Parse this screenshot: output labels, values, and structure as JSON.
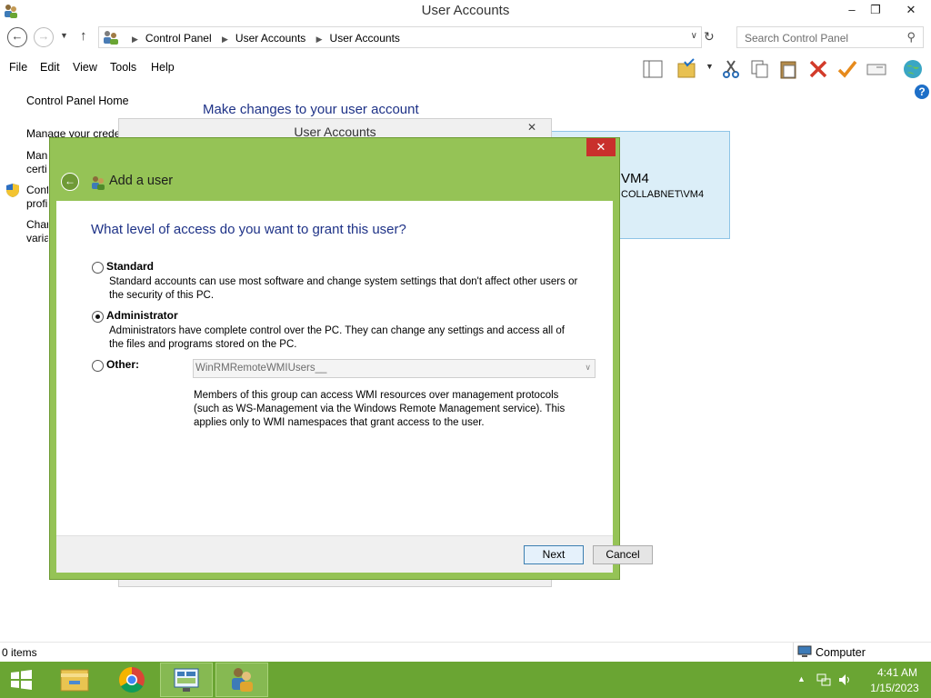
{
  "window": {
    "title": "User Accounts",
    "minimize_glyph": "–",
    "maximize_glyph": "❐",
    "close_glyph": "✕"
  },
  "address": {
    "crumbs": [
      "Control Panel",
      "User Accounts",
      "User Accounts"
    ],
    "search_placeholder": "Search Control Panel"
  },
  "menu": {
    "items": [
      "File",
      "Edit",
      "View",
      "Tools",
      "Help"
    ]
  },
  "toolbar_icons": [
    "layout-icon",
    "folder-check-icon",
    "cut-icon",
    "copy-icon",
    "paste-icon",
    "delete-icon",
    "checkmark-icon",
    "rename-icon",
    "globe-icon"
  ],
  "left_nav": {
    "home": "Control Panel Home",
    "items": [
      "Manage your crede",
      "Man",
      "certi",
      "Confi",
      "profi",
      "Char",
      "varia"
    ]
  },
  "main": {
    "heading": "Make changes to your user account"
  },
  "account_card": {
    "name": "VM4",
    "domain": "COLLABNET\\VM4"
  },
  "bg_dialog": {
    "title": "User Accounts",
    "close_glyph": "✕"
  },
  "dialog": {
    "close_glyph": "✕",
    "back_glyph": "←",
    "header": "Add a user",
    "question": "What level of access do you want to grant this user?",
    "options": [
      {
        "label": "Standard",
        "desc1": "Standard accounts can use most software and change system settings that don't affect other users or",
        "desc2": "the security of this PC.",
        "checked": false
      },
      {
        "label": "Administrator",
        "desc1": "Administrators have complete control over the PC. They can change any settings and access all of",
        "desc2": "the files and programs stored on the PC.",
        "checked": true
      },
      {
        "label": "Other:",
        "checked": false
      }
    ],
    "group_value": "WinRMRemoteWMIUsers__",
    "group_desc": [
      "Members of this group can access WMI resources over management protocols",
      "(such as WS-Management via the Windows Remote Management service). This",
      "applies only to WMI namespaces that grant access to the user."
    ],
    "next": "Next",
    "cancel": "Cancel"
  },
  "status": {
    "items": "0 items",
    "location": "Computer"
  },
  "taskbar": {
    "apps": [
      "start-button",
      "file-explorer",
      "chrome",
      "server-manager",
      "user-accounts"
    ],
    "time": "4:41 AM",
    "date": "1/15/2023"
  },
  "colors": {
    "accent_green": "#95c356",
    "taskbar_green": "#6aa533",
    "heading_blue": "#1e3287",
    "close_red": "#c9302c"
  }
}
